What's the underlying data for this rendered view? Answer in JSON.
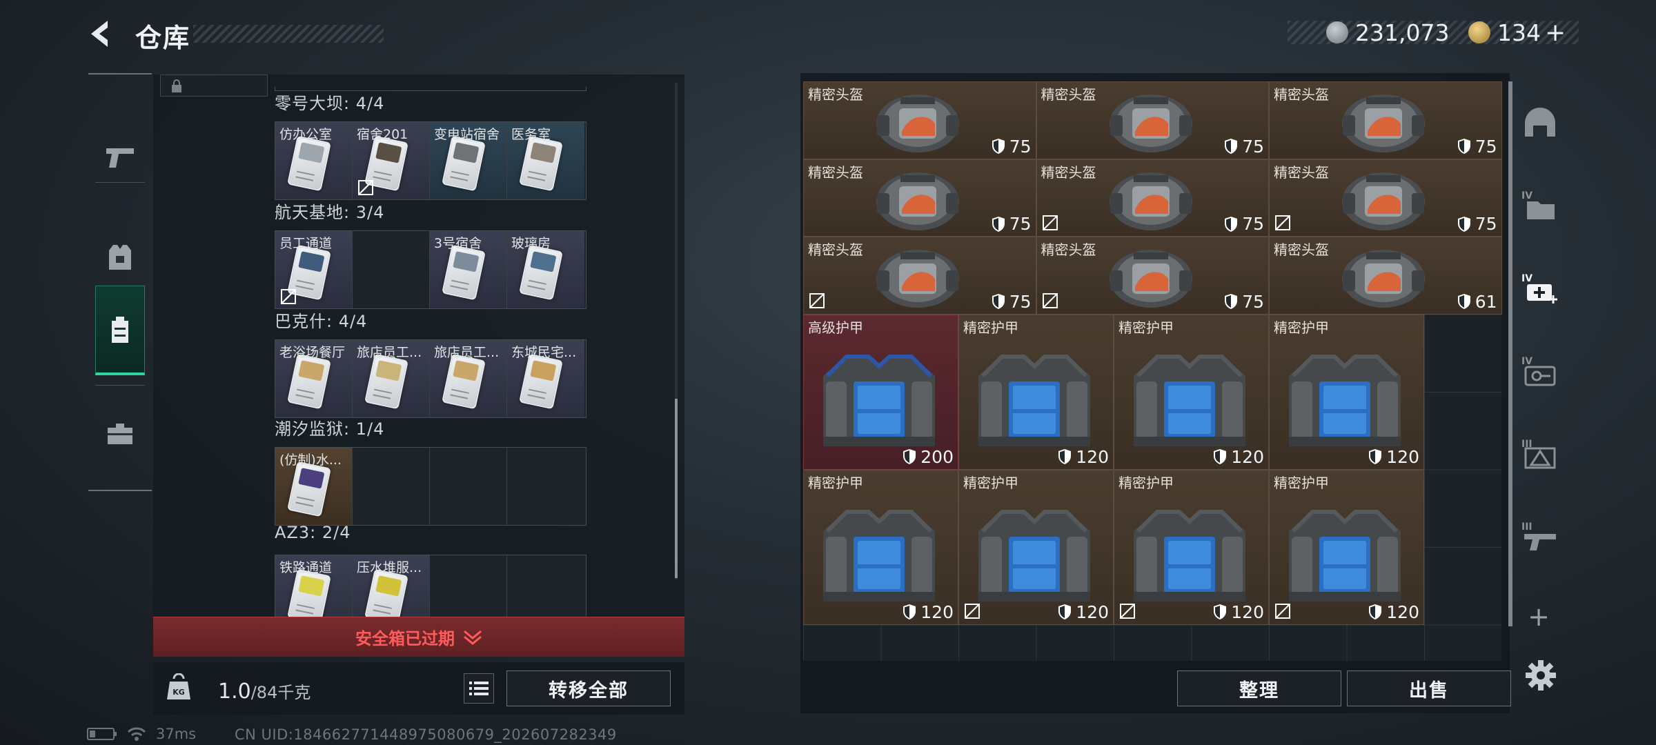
{
  "header": {
    "title": "仓库",
    "currency_silver": "231,073",
    "currency_gold": "134",
    "gold_plus": "+"
  },
  "left_tabs": [
    "weapon-tab",
    "armor-tab",
    "backpack-tab",
    "case-tab"
  ],
  "sections": [
    {
      "name": "零号大坝: 4/4",
      "cells": [
        {
          "label": "仿办公室",
          "bg": "bg1",
          "strip": "#9ea6ad",
          "no": false
        },
        {
          "label": "宿舍201",
          "bg": "bg1",
          "strip": "#5a4f43",
          "no": true
        },
        {
          "label": "变电站宿舍",
          "bg": "bg2",
          "strip": "#6e7378",
          "no": false
        },
        {
          "label": "医务室",
          "bg": "bg2",
          "strip": "#8e8377",
          "no": false
        }
      ]
    },
    {
      "name": "航天基地: 3/4",
      "cells": [
        {
          "label": "员工通道",
          "bg": "bg1",
          "strip": "#3f5c7c",
          "no": true
        },
        {
          "label": "",
          "bg": "empty",
          "strip": "",
          "no": false
        },
        {
          "label": "3号宿舍",
          "bg": "bg1",
          "strip": "#7d8c9c",
          "no": false
        },
        {
          "label": "玻璃房",
          "bg": "bg1",
          "strip": "#4f6f8e",
          "no": false
        }
      ]
    },
    {
      "name": "巴克什: 4/4",
      "cells": [
        {
          "label": "老浴场餐厅",
          "bg": "bg1",
          "strip": "#c9a66a",
          "no": false
        },
        {
          "label": "旅店员工...",
          "bg": "bg1",
          "strip": "#c9b47a",
          "no": false
        },
        {
          "label": "旅店员工...",
          "bg": "bg1",
          "strip": "#c9a66a",
          "no": false
        },
        {
          "label": "东城民宅...",
          "bg": "bg1",
          "strip": "#c8a25e",
          "no": false
        }
      ]
    },
    {
      "name": "潮汐监狱: 1/4",
      "cells": [
        {
          "label": "(仿制)水...",
          "bg": "bg3",
          "strip": "#4b3f7e",
          "no": false
        },
        {
          "label": "",
          "bg": "empty",
          "strip": "",
          "no": false
        },
        {
          "label": "",
          "bg": "empty",
          "strip": "",
          "no": false
        },
        {
          "label": "",
          "bg": "empty",
          "strip": "",
          "no": false
        }
      ]
    },
    {
      "name": "AZ3: 2/4",
      "cells": [
        {
          "label": "铁路通道",
          "bg": "bg1",
          "strip": "#d8d24a",
          "no": false
        },
        {
          "label": "压水堆服...",
          "bg": "bg1",
          "strip": "#d2c23a",
          "no": false
        },
        {
          "label": "",
          "bg": "empty",
          "strip": "",
          "no": false
        },
        {
          "label": "",
          "bg": "empty",
          "strip": "",
          "no": false
        }
      ]
    }
  ],
  "expired_text": "安全箱已过期",
  "weight": {
    "current": "1.0",
    "max": "/84千克"
  },
  "buttons": {
    "transfer_all": "转移全部",
    "organize": "整理",
    "sell": "出售"
  },
  "helmets": [
    {
      "name": "精密头盔",
      "durability": "75",
      "no": false
    },
    {
      "name": "精密头盔",
      "durability": "75",
      "no": false
    },
    {
      "name": "精密头盔",
      "durability": "75",
      "no": false
    },
    {
      "name": "精密头盔",
      "durability": "75",
      "no": false
    },
    {
      "name": "精密头盔",
      "durability": "75",
      "no": true
    },
    {
      "name": "精密头盔",
      "durability": "75",
      "no": true
    },
    {
      "name": "精密头盔",
      "durability": "75",
      "no": true
    },
    {
      "name": "精密头盔",
      "durability": "75",
      "no": true
    },
    {
      "name": "精密头盔",
      "durability": "61",
      "no": false
    }
  ],
  "armors": [
    {
      "name": "高级护甲",
      "durability": "200",
      "no": false,
      "red": true
    },
    {
      "name": "精密护甲",
      "durability": "120",
      "no": false,
      "red": false
    },
    {
      "name": "精密护甲",
      "durability": "120",
      "no": false,
      "red": false
    },
    {
      "name": "精密护甲",
      "durability": "120",
      "no": false,
      "red": false
    },
    {
      "name": "精密护甲",
      "durability": "120",
      "no": false,
      "red": false
    },
    {
      "name": "精密护甲",
      "durability": "120",
      "no": true,
      "red": false
    },
    {
      "name": "精密护甲",
      "durability": "120",
      "no": true,
      "red": false
    },
    {
      "name": "精密护甲",
      "durability": "120",
      "no": true,
      "red": false
    }
  ],
  "right_tabs": [
    {
      "name": "helmet-category-icon",
      "tier": ""
    },
    {
      "name": "folder-tier4-icon",
      "tier": "IV"
    },
    {
      "name": "medkit-tier4-icon",
      "tier": "IV"
    },
    {
      "name": "key-tier4-icon",
      "tier": "IV"
    },
    {
      "name": "pyramid-tier3-icon",
      "tier": "III"
    },
    {
      "name": "gun-tier3-icon",
      "tier": "III"
    }
  ],
  "status": {
    "ping": "37ms",
    "uid": "CN UID:184662771448975080679_202607282349"
  }
}
